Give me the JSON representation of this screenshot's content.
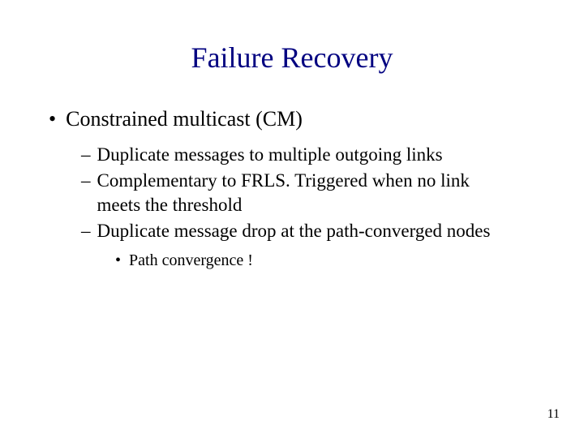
{
  "title": "Failure Recovery",
  "level1_item": "Constrained multicast (CM)",
  "level2_items": [
    "Duplicate messages to multiple outgoing links",
    "Complementary to FRLS. Triggered when no link meets the threshold",
    "Duplicate message drop at the path-converged nodes"
  ],
  "level3_item": "Path convergence !",
  "page_number": "11"
}
